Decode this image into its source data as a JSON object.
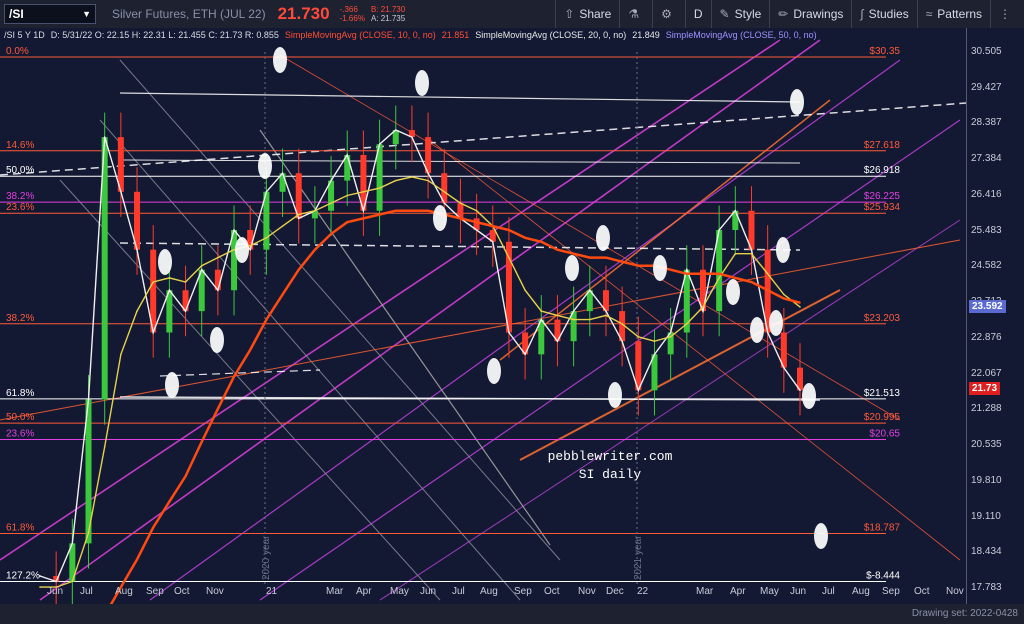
{
  "toolbar": {
    "symbol": "/SI",
    "instrument": "Silver Futures, ETH (JUL 22)",
    "last_price": "21.730",
    "change": "-.366",
    "change_pct": "-1.66%",
    "bid": "B: 21.730",
    "ask": "A: 21.735",
    "share_label": "Share",
    "interval_label": "D",
    "style_label": "Style",
    "drawings_label": "Drawings",
    "studies_label": "Studies",
    "patterns_label": "Patterns"
  },
  "legend": {
    "header": "/SI 5 Y 1D",
    "ohlc": "D: 5/31/22  O: 22.15  H: 22.31  L: 21.455  C: 21.73  R: 0.855",
    "sma10": "SimpleMovingAvg (CLOSE, 10, 0, no)",
    "sma10_value": "21.851",
    "sma20": "SimpleMovingAvg (CLOSE, 20, 0, no)",
    "sma20_value": "21.849",
    "sma50": "SimpleMovingAvg (CLOSE, 50, 0, no)"
  },
  "footer": {
    "drawing_set": "Drawing set: 2022-0428"
  },
  "colors": {
    "background": "#141933",
    "up": "#3cc83c",
    "down": "#ff3a2a",
    "sma10": "#ff5030",
    "sma20": "#e6e6e6",
    "sma50": "#a090ff",
    "sma200": "#ff4a10",
    "fib": "#ff5a3a",
    "fib_alt": "#e040e0"
  },
  "chart_data": {
    "type": "line",
    "title": "SI daily",
    "watermark": "pebblewriter.com",
    "x_ticks": [
      "Jun",
      "Jul",
      "Aug",
      "Sep",
      "Oct",
      "Nov",
      "21",
      "Mar",
      "Apr",
      "May",
      "Jun",
      "Jul",
      "Aug",
      "Sep",
      "Oct",
      "Nov",
      "Dec",
      "22",
      "Mar",
      "Apr",
      "May",
      "Jun",
      "Jul",
      "Aug",
      "Sep",
      "Oct",
      "Nov"
    ],
    "y_ticks": [
      "30.505",
      "29.427",
      "28.387",
      "27.384",
      "26.416",
      "25.483",
      "24.582",
      "23.713",
      "22.876",
      "22.067",
      "21.288",
      "20.535",
      "19.810",
      "19.110",
      "18.434",
      "17.783"
    ],
    "y_range": [
      17.783,
      30.505
    ],
    "y_scale": "log",
    "last_price_badge": "21.73",
    "sma_badge": "23.592",
    "year_labels": [
      "2020 year",
      "2021 year"
    ],
    "fib_levels": [
      {
        "pct": "0.0%",
        "price": "$30.35",
        "value": 30.35,
        "color": "#ff5a3a"
      },
      {
        "pct": "14.6%",
        "price": "$27.618",
        "value": 27.618,
        "color": "#ff5a3a"
      },
      {
        "pct": "50.0%",
        "price": "$26.918",
        "value": 26.918,
        "color": "#ffffff"
      },
      {
        "pct": "38.2%",
        "price": "$26.225",
        "value": 26.225,
        "color": "#e040e0"
      },
      {
        "pct": "23.6%",
        "price": "$25.934",
        "value": 25.934,
        "color": "#ff5a3a"
      },
      {
        "pct": "38.2%",
        "price": "$23.203",
        "value": 23.203,
        "color": "#ff5a3a"
      },
      {
        "pct": "61.8%",
        "price": "$21.513",
        "value": 21.513,
        "color": "#ffffff"
      },
      {
        "pct": "50.0%",
        "price": "$20.995",
        "value": 20.995,
        "color": "#ff5a3a"
      },
      {
        "pct": "23.6%",
        "price": "$20.65",
        "value": 20.65,
        "color": "#e040e0"
      },
      {
        "pct": "61.8%",
        "price": "$18.787",
        "value": 18.787,
        "color": "#ff5a3a"
      },
      {
        "pct": "127.2%",
        "price": "$-8.444",
        "value": 17.9,
        "color": "#ffffff"
      }
    ],
    "price_series": [
      {
        "name": "close",
        "values": [
          18.0,
          17.9,
          18.6,
          21.5,
          28.0,
          26.5,
          25.0,
          23.0,
          24.0,
          23.5,
          24.5,
          24.0,
          25.5,
          25.0,
          26.5,
          27.0,
          25.8,
          26.0,
          26.8,
          27.5,
          26.0,
          27.8,
          28.2,
          28.0,
          27.0,
          26.2,
          25.8,
          25.5,
          25.2,
          23.0,
          22.5,
          23.3,
          22.8,
          23.5,
          24.0,
          23.5,
          22.8,
          21.7,
          22.5,
          23.0,
          24.5,
          23.5,
          25.5,
          26.0,
          25.0,
          23.0,
          22.2,
          21.7
        ]
      },
      {
        "name": "SMA 50",
        "values": [
          17.8,
          17.8,
          17.9,
          18.8,
          20.5,
          22.5,
          23.5,
          24.2,
          24.3,
          24.2,
          24.6,
          24.8,
          25.0,
          25.1,
          25.3,
          25.6,
          25.9,
          26.0,
          26.2,
          26.4,
          26.5,
          26.6,
          26.8,
          26.9,
          26.8,
          26.5,
          26.2,
          26.0,
          25.6,
          24.8,
          24.0,
          23.5,
          23.4,
          23.3,
          23.3,
          23.4,
          23.2,
          22.9,
          22.8,
          22.9,
          23.2,
          23.6,
          24.3,
          24.9,
          24.9,
          24.4,
          23.9,
          23.6
        ]
      },
      {
        "name": "SMA 200",
        "values": [
          17.0,
          17.0,
          17.0,
          17.1,
          17.3,
          17.8,
          18.3,
          18.9,
          19.4,
          19.9,
          20.6,
          21.3,
          22.0,
          22.6,
          23.3,
          23.9,
          24.5,
          25.0,
          25.4,
          25.7,
          25.8,
          25.9,
          26.0,
          26.0,
          26.0,
          25.9,
          25.8,
          25.7,
          25.6,
          25.5,
          25.3,
          25.2,
          25.0,
          24.9,
          24.8,
          24.8,
          24.7,
          24.6,
          24.6,
          24.5,
          24.4,
          24.4,
          24.4,
          24.3,
          24.2,
          24.0,
          23.8,
          23.7
        ]
      }
    ]
  }
}
